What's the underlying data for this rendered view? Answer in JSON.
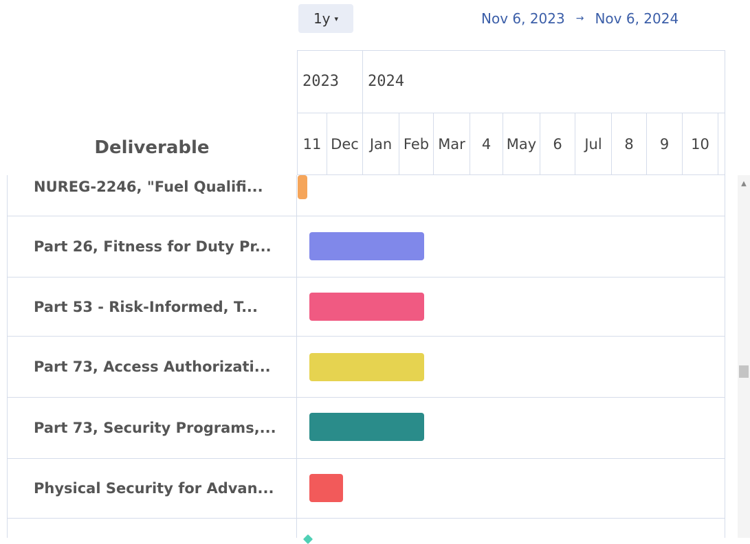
{
  "toolbar": {
    "zoom_label": "1y",
    "range_start": "Nov 6, 2023",
    "range_arrow": "→",
    "range_end": "Nov 6, 2024"
  },
  "timeline": {
    "years": [
      "2023",
      "2024"
    ],
    "months": [
      "11",
      "Dec",
      "Jan",
      "Feb",
      "Mar",
      "4",
      "May",
      "6",
      "Jul",
      "8",
      "9",
      "10"
    ]
  },
  "grid": {
    "column_header": "Deliverable",
    "rows": [
      {
        "label": "NUREG-2246, \"Fuel Qualifi...",
        "color": "#f5a55a"
      },
      {
        "label": "Part 26, Fitness for Duty Pr...",
        "color": "#8088ea"
      },
      {
        "label": "Part 53 - Risk-Informed, T...",
        "color": "#f05a82"
      },
      {
        "label": "Part 73, Access Authorizati...",
        "color": "#e6d350"
      },
      {
        "label": "Part 73, Security Programs,...",
        "color": "#2a8c8a"
      },
      {
        "label": "Physical Security for Advan...",
        "color": "#f25a5a"
      },
      {
        "label": "",
        "color": "#4fd0b5"
      }
    ]
  }
}
